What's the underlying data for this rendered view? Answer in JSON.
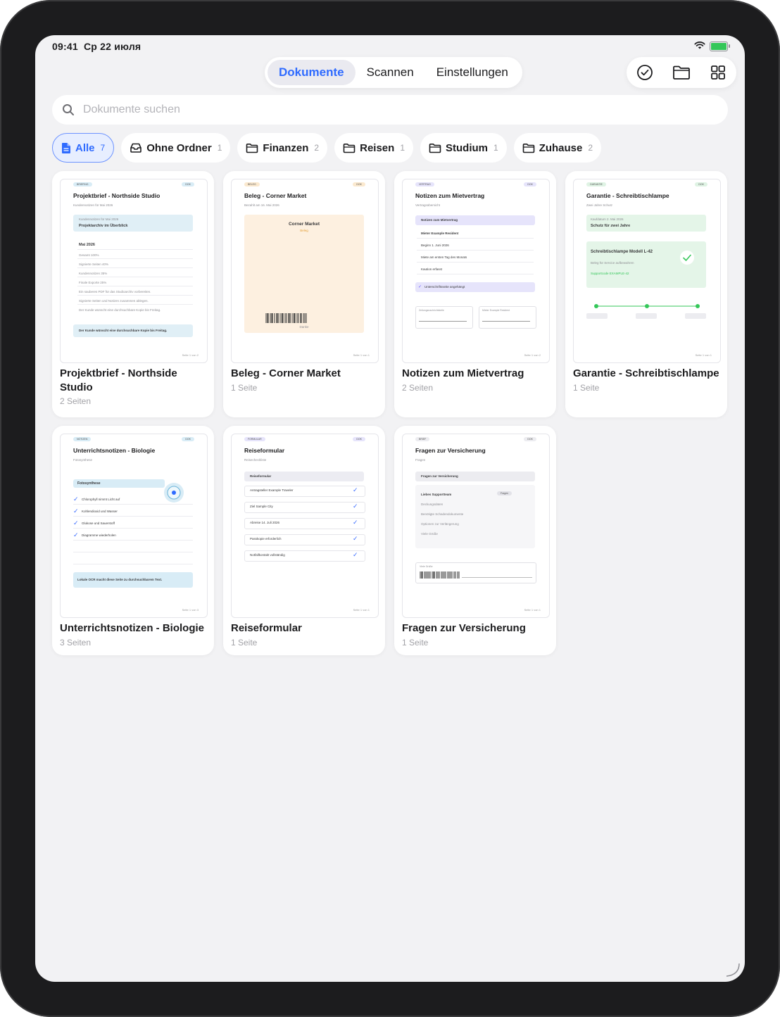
{
  "status": {
    "time": "09:41",
    "date": "Ср 22 июля"
  },
  "tabs": [
    {
      "label": "Dokumente",
      "active": true
    },
    {
      "label": "Scannen",
      "active": false
    },
    {
      "label": "Einstellungen",
      "active": false
    }
  ],
  "toolbar": {
    "icons": [
      "checkmark-circle-icon",
      "folder-icon",
      "grid-icon"
    ]
  },
  "search": {
    "placeholder": "Dokumente suchen",
    "value": ""
  },
  "filters": [
    {
      "label": "Alle",
      "count": "7",
      "icon": "document-icon",
      "active": true
    },
    {
      "label": "Ohne Ordner",
      "count": "1",
      "icon": "tray-icon",
      "active": false
    },
    {
      "label": "Finanzen",
      "count": "2",
      "icon": "folder-icon",
      "active": false
    },
    {
      "label": "Reisen",
      "count": "1",
      "icon": "folder-icon",
      "active": false
    },
    {
      "label": "Studium",
      "count": "1",
      "icon": "folder-icon",
      "active": false
    },
    {
      "label": "Zuhause",
      "count": "2",
      "icon": "folder-icon",
      "active": false
    }
  ],
  "documents": [
    {
      "title": "Projektbrief - Northside Studio",
      "pages": "2 Seiten",
      "preview": {
        "tag": "BRIEFING",
        "badge": "DOK",
        "heading": "Projektbrief - Northside Studio",
        "meta": "Kundennotizen für Mai 2026",
        "hl_small": "Kundennotizen für Mai 2026",
        "hl_bold": "Projektarchiv im Überblick",
        "section": "Mai 2026",
        "lines": [
          "Gesamt 100%",
          "Signierte Seiten 40%",
          "Kundennotizen 35%",
          "Finale Exporte 25%",
          "Ein sauberes PDF für das Studioarchiv vorbereiten.",
          "Signierte Seiten und Notizen zusammen ablegen.",
          "Der Kunde wünscht eine durchsuchbare Kopie bis Freitag."
        ],
        "callout": "Der Kunde wünscht eine durchsuchbare Kopie bis Freitag.",
        "footer": "Seite 1 von 2"
      }
    },
    {
      "title": "Beleg - Corner Market",
      "pages": "1 Seite",
      "preview": {
        "tag": "BELEG",
        "badge": "DOK",
        "heading": "Beleg - Corner Market",
        "meta": "Bezahlt am 16. Mai 2026",
        "receipt_title": "Corner Market",
        "receipt_sub": "Beleg",
        "receipt_thanks": "Danke",
        "footer": "Seite 1 von 1"
      }
    },
    {
      "title": "Notizen zum Mietvertrag",
      "pages": "2 Seiten",
      "preview": {
        "tag": "VERTRAG",
        "badge": "DOK",
        "heading": "Notizen zum Mietvertrag",
        "meta": "Vertragsübersicht",
        "lines": [
          "Notizen zum Mietvertrag",
          "Mieter Example Resident",
          "Beginn 1. Juni 2026",
          "Miete am ersten Tag des Monats",
          "Kaution erfasst"
        ],
        "check": "Unterschriftsseite angehängt",
        "sig_left": "Zeitungsnachrichtsteile",
        "sig_right": "Mieter Example Resident",
        "footer": "Seite 1 von 2"
      }
    },
    {
      "title": "Garantie - Schreibtischlampe",
      "pages": "1 Seite",
      "preview": {
        "tag": "GARANTIE",
        "badge": "DOK",
        "heading": "Garantie - Schreibtischlampe",
        "meta": "Zwei Jahre Schutz",
        "hl_small": "Kaufdatum 2. Mai 2026",
        "hl_bold": "Schutz für zwei Jahre",
        "product": "Schreibtischlampe Modell L-42",
        "product_sub": "Beleg für Service aufbewahren",
        "product_code": "Supportcode EXAMPLE-42",
        "footer": "Seite 1 von 1"
      }
    },
    {
      "title": "Unterrichtsnotizen - Biologie",
      "pages": "3 Seiten",
      "preview": {
        "tag": "NOTIZEN",
        "badge": "DOK",
        "heading": "Unterrichtsnotizen - Biologie",
        "meta": "Fotosynthese",
        "section": "Fotosynthese",
        "lines": [
          "Chlorophyll nimmt Licht auf",
          "Kohlendioxid und Wasser",
          "Glukose und Sauerstoff",
          "Diagramme wiederholen"
        ],
        "callout": "Lokale OCR macht diese Seite zu durchsuchbarem Text.",
        "footer": "Seite 1 von 3"
      }
    },
    {
      "title": "Reiseformular",
      "pages": "1 Seite",
      "preview": {
        "tag": "FORMULAR",
        "badge": "DOK",
        "heading": "Reiseformular",
        "meta": "Reisecheckliste",
        "section": "Reiseformular",
        "lines": [
          "Antragsteller Example Traveler",
          "Ziel Sample City",
          "Abreise 14. Juli 2026",
          "Passkopie erforderlich",
          "Notfallkontakt vollständig"
        ],
        "footer": "Seite 1 von 1"
      }
    },
    {
      "title": "Fragen zur Versicherung",
      "pages": "1 Seite",
      "preview": {
        "tag": "BRIEF",
        "badge": "DOK",
        "heading": "Fragen zur Versicherung",
        "meta": "Fragen",
        "section": "Fragen zur Versicherung",
        "greeting": "Liebes Supportteam",
        "pill": "Fragen",
        "lines": [
          "Deckungsdaten",
          "Benötigte Schadendokumente",
          "Optionen zur Verlängerung",
          "Viele Grüße"
        ],
        "sig_label": "Viele Grüße",
        "footer": "Seite 1 von 1"
      }
    }
  ],
  "colors": {
    "accent": "#2f6bff",
    "background": "#f2f2f4",
    "card": "#ffffff",
    "green": "#34c759"
  }
}
